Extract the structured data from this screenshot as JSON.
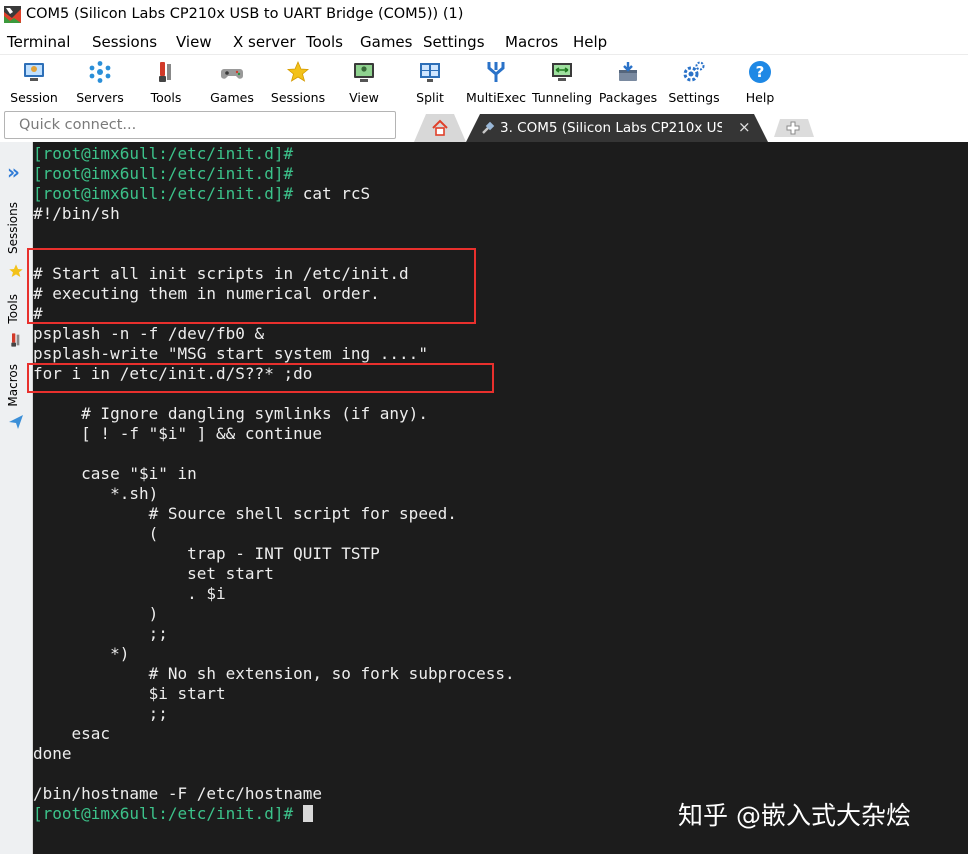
{
  "window": {
    "title": "COM5  (Silicon Labs CP210x USB to UART Bridge (COM5)) (1)"
  },
  "menu": [
    "Terminal",
    "Sessions",
    "View",
    "X server",
    "Tools",
    "Games",
    "Settings",
    "Macros",
    "Help"
  ],
  "toolbar": [
    {
      "label": "Session",
      "icon": "session-icon"
    },
    {
      "label": "Servers",
      "icon": "servers-icon"
    },
    {
      "label": "Tools",
      "icon": "tools-icon"
    },
    {
      "label": "Games",
      "icon": "games-icon"
    },
    {
      "label": "Sessions",
      "icon": "star-icon"
    },
    {
      "label": "View",
      "icon": "view-icon"
    },
    {
      "label": "Split",
      "icon": "split-icon"
    },
    {
      "label": "MultiExec",
      "icon": "multiexec-icon"
    },
    {
      "label": "Tunneling",
      "icon": "tunneling-icon"
    },
    {
      "label": "Packages",
      "icon": "packages-icon"
    },
    {
      "label": "Settings",
      "icon": "gear-icon"
    },
    {
      "label": "Help",
      "icon": "help-icon"
    }
  ],
  "quick_connect": {
    "placeholder": "Quick connect..."
  },
  "tabs": {
    "active_label": "3. COM5  (Silicon Labs CP210x USB",
    "close": "×"
  },
  "sidebar": {
    "sessions": "Sessions",
    "tools": "Tools",
    "macros": "Macros",
    "chevron": "»"
  },
  "terminal": {
    "lines": [
      {
        "prompt": "[root@imx6ull:/etc/init.d]#",
        "text": ""
      },
      {
        "prompt": "[root@imx6ull:/etc/init.d]#",
        "text": ""
      },
      {
        "prompt": "[root@imx6ull:/etc/init.d]#",
        "text": " cat rcS"
      },
      {
        "prompt": "",
        "text": "#!/bin/sh"
      },
      {
        "prompt": "",
        "text": ""
      },
      {
        "prompt": "",
        "text": ""
      },
      {
        "prompt": "",
        "text": "# Start all init scripts in /etc/init.d"
      },
      {
        "prompt": "",
        "text": "# executing them in numerical order."
      },
      {
        "prompt": "",
        "text": "#"
      },
      {
        "prompt": "",
        "text": "psplash -n -f /dev/fb0 &"
      },
      {
        "prompt": "",
        "text": "psplash-write \"MSG start system ing ....\""
      },
      {
        "prompt": "",
        "text": "for i in /etc/init.d/S??* ;do"
      },
      {
        "prompt": "",
        "text": ""
      },
      {
        "prompt": "",
        "text": "     # Ignore dangling symlinks (if any)."
      },
      {
        "prompt": "",
        "text": "     [ ! -f \"$i\" ] && continue"
      },
      {
        "prompt": "",
        "text": ""
      },
      {
        "prompt": "",
        "text": "     case \"$i\" in"
      },
      {
        "prompt": "",
        "text": "        *.sh)"
      },
      {
        "prompt": "",
        "text": "            # Source shell script for speed."
      },
      {
        "prompt": "",
        "text": "            ("
      },
      {
        "prompt": "",
        "text": "                trap - INT QUIT TSTP"
      },
      {
        "prompt": "",
        "text": "                set start"
      },
      {
        "prompt": "",
        "text": "                . $i"
      },
      {
        "prompt": "",
        "text": "            )"
      },
      {
        "prompt": "",
        "text": "            ;;"
      },
      {
        "prompt": "",
        "text": "        *)"
      },
      {
        "prompt": "",
        "text": "            # No sh extension, so fork subprocess."
      },
      {
        "prompt": "",
        "text": "            $i start"
      },
      {
        "prompt": "",
        "text": "            ;;"
      },
      {
        "prompt": "",
        "text": "    esac"
      },
      {
        "prompt": "",
        "text": "done"
      },
      {
        "prompt": "",
        "text": ""
      },
      {
        "prompt": "",
        "text": "/bin/hostname -F /etc/hostname"
      },
      {
        "prompt": "[root@imx6ull:/etc/init.d]#",
        "text": " "
      }
    ]
  },
  "watermark": "知乎 @嵌入式大杂烩",
  "colors": {
    "terminal_bg": "#1c1c1c",
    "prompt": "#3cc28a",
    "highlight": "#e8302d",
    "text": "#ededed"
  }
}
